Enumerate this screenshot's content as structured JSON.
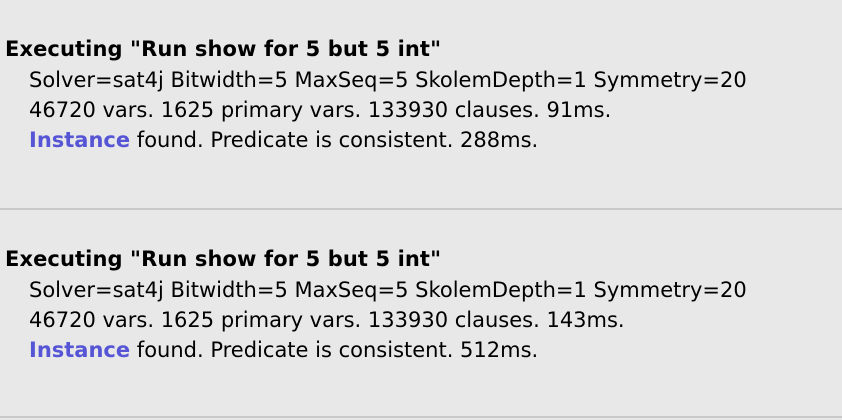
{
  "log": {
    "entries": [
      {
        "command": "Executing \"Run show for 5 but 5 int\"",
        "solver_line": "Solver=sat4j Bitwidth=5 MaxSeq=5 SkolemDepth=1 Symmetry=20",
        "stats_line": "46720 vars. 1625 primary vars. 133930 clauses. 91ms.",
        "result_link": "Instance",
        "result_text": " found. Predicate is consistent. 288ms."
      },
      {
        "command": "Executing \"Run show for 5 but 5 int\"",
        "solver_line": "Solver=sat4j Bitwidth=5 MaxSeq=5 SkolemDepth=1 Symmetry=20",
        "stats_line": "46720 vars. 1625 primary vars. 133930 clauses. 143ms.",
        "result_link": "Instance",
        "result_text": " found. Predicate is consistent. 512ms."
      }
    ]
  },
  "colors": {
    "background": "#e8e8e8",
    "link": "#5555d6",
    "separator": "#c9c9c9"
  }
}
